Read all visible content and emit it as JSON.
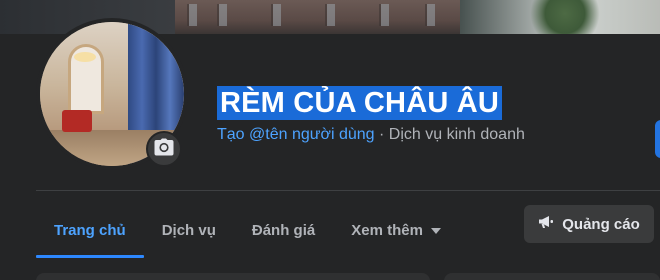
{
  "page": {
    "name": "RÈM CỦA CHÂU ÂU",
    "username_link": "Tạo @tên người dùng",
    "separator": "·",
    "category": "Dịch vụ kinh doanh"
  },
  "tabs": [
    {
      "label": "Trang chủ",
      "active": true
    },
    {
      "label": "Dịch vụ",
      "active": false
    },
    {
      "label": "Đánh giá",
      "active": false
    },
    {
      "label": "Xem thêm",
      "active": false
    }
  ],
  "actions": {
    "ads_label": "Quảng cáo"
  },
  "icons": {
    "camera": "camera-icon",
    "megaphone": "megaphone-icon",
    "dropdown": "caret-down-icon"
  },
  "colors": {
    "background": "#242526",
    "accent": "#2d88ff",
    "name_highlight": "#1a6bd8",
    "muted_text": "#b0b3b8"
  }
}
